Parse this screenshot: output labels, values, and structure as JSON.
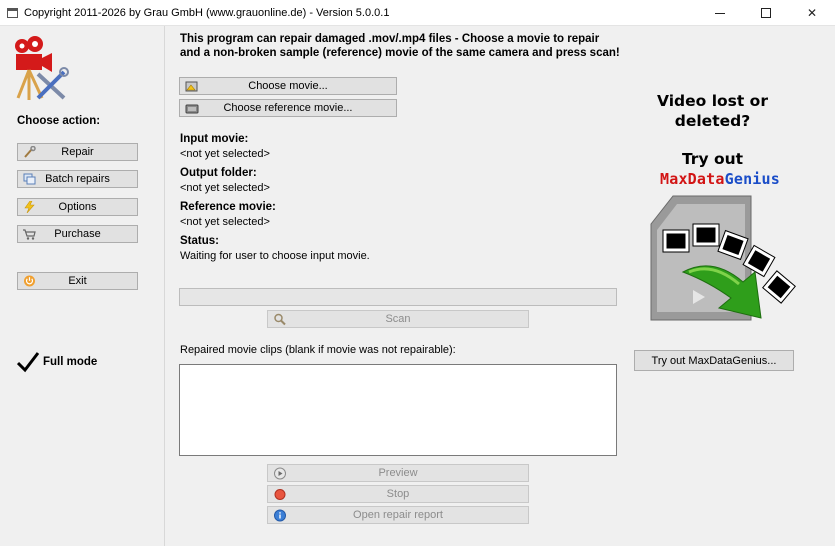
{
  "window": {
    "title": "Copyright 2011-2026 by Grau GmbH (www.grauonline.de) - Version 5.0.0.1"
  },
  "sidebar": {
    "heading": "Choose action:",
    "items": [
      {
        "label": "Repair",
        "icon": "wrench-icon"
      },
      {
        "label": "Batch repairs",
        "icon": "batch-icon"
      },
      {
        "label": "Options",
        "icon": "options-icon"
      },
      {
        "label": "Purchase",
        "icon": "cart-icon"
      }
    ],
    "exit_label": "Exit",
    "mode_label": "Full mode"
  },
  "main": {
    "intro": "This program can repair damaged .mov/.mp4 files - Choose a movie to repair and a non-broken sample (reference) movie of the same camera and press scan!",
    "choose_movie": "Choose movie...",
    "choose_reference": "Choose reference movie...",
    "input_label": "Input movie:",
    "input_value": "<not yet selected>",
    "output_label": "Output folder:",
    "output_value": "<not yet selected>",
    "reference_label": "Reference movie:",
    "reference_value": "<not yet selected>",
    "status_label": "Status:",
    "status_value": "Waiting for user to choose input movie.",
    "progress": 0,
    "scan_label": "Scan",
    "clips_label": "Repaired movie clips (blank if movie was not repairable):",
    "clips": [],
    "preview_label": "Preview",
    "stop_label": "Stop",
    "report_label": "Open repair report"
  },
  "promo": {
    "line1": "Video lost or",
    "line2": "deleted?",
    "try_out": "Try out",
    "brand_part1": "MaxData",
    "brand_part2": "Genius",
    "button_label": "Try out MaxDataGenius..."
  },
  "colors": {
    "brand_red": "#d21414",
    "brand_blue": "#1a4dc8",
    "arrow_green": "#2f9e1b"
  }
}
